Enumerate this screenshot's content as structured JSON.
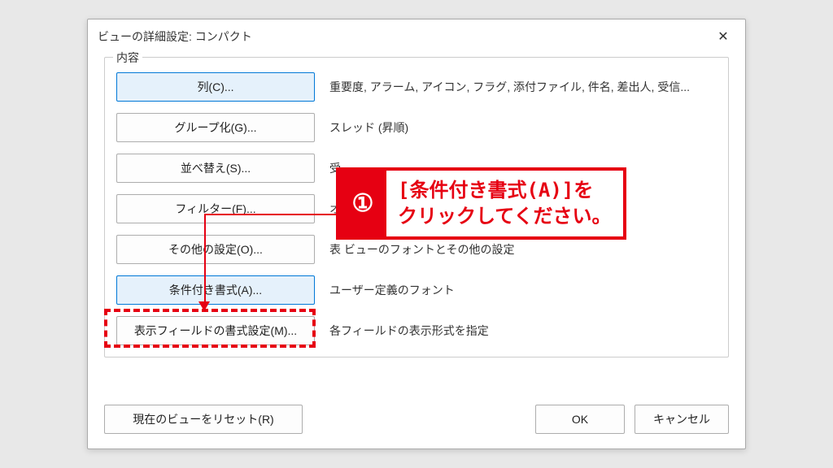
{
  "dialog": {
    "title": "ビューの詳細設定: コンパクト",
    "close_label": "✕"
  },
  "fieldset": {
    "legend": "内容",
    "rows": [
      {
        "button": "列(C)...",
        "desc": "重要度, アラーム, アイコン, フラグ, 添付ファイル, 件名, 差出人, 受信...",
        "selected": true
      },
      {
        "button": "グループ化(G)...",
        "desc": "スレッド (昇順)",
        "selected": false
      },
      {
        "button": "並べ替え(S)...",
        "desc": "受",
        "selected": false
      },
      {
        "button": "フィルター(F)...",
        "desc": "オフ",
        "selected": false
      },
      {
        "button": "その他の設定(O)...",
        "desc": "表 ビューのフォントとその他の設定",
        "selected": false
      },
      {
        "button": "条件付き書式(A)...",
        "desc": "ユーザー定義のフォント",
        "selected": true
      },
      {
        "button": "表示フィールドの書式設定(M)...",
        "desc": "各フィールドの表示形式を指定",
        "selected": false
      }
    ]
  },
  "bottom": {
    "reset": "現在のビューをリセット(R)",
    "ok": "OK",
    "cancel": "キャンセル"
  },
  "annotation": {
    "number": "①",
    "text": "[条件付き書式(A)]を\nクリックしてください。"
  }
}
